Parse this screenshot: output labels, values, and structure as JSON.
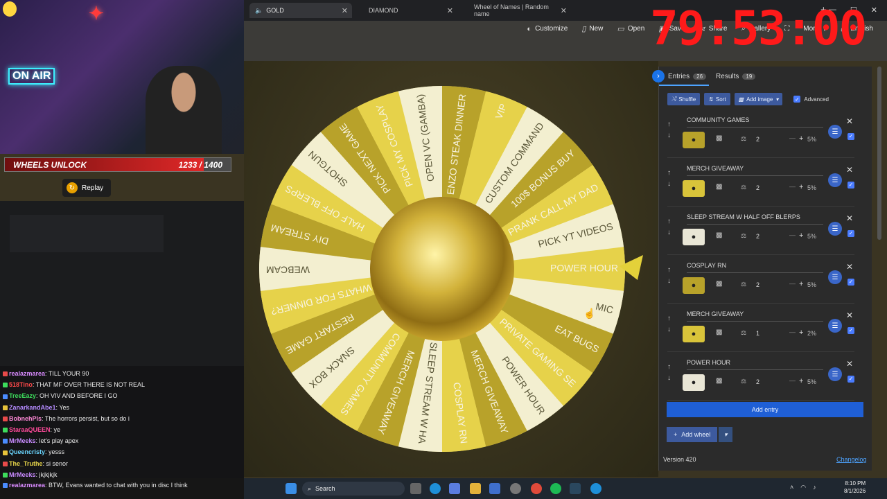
{
  "browser": {
    "tabs": [
      {
        "label": "GOLD",
        "active": true
      },
      {
        "label": "DIAMOND",
        "active": false
      },
      {
        "label": "Wheel of Names | Random name",
        "active": false
      }
    ],
    "new_tab_icon": "plus-icon"
  },
  "timer": {
    "text": "79:53:00"
  },
  "menu": {
    "customize": "Customize",
    "new": "New",
    "open": "Open",
    "save": "Save",
    "share": "Share",
    "gallery": "Gallery",
    "more": "More",
    "language": "English"
  },
  "stream": {
    "on_air": "ON AIR",
    "unlock_label": "WHEELS UNLOCK",
    "unlock_count": "1233 / 1400",
    "unlock_progress": 0.88,
    "replay": "Replay"
  },
  "wheel": {
    "colors": {
      "gold_dark": "#b8a22a",
      "gold_light": "#e6d24a",
      "cream": "#f3efd0"
    },
    "segments": [
      "POWER HOUR",
      "MIC",
      "EAT BUGS",
      "PRIVATE GAMING SE",
      "POWER HOUR",
      "MERCH GIVEAWAY",
      "COSPLAY RN",
      "SLEEP STREAM W HA",
      "MERCH GIVEAWAY",
      "COMMUNITY GAMES",
      "SNACK BOX",
      "RESTART GAME",
      "WHATS FOR DINNER?",
      "WEBCAM",
      "DIY STREAM",
      "HALF OFF BLERPS",
      "SHOTGUN",
      "PICK NEXT GAME",
      "PICK MY COSPLAY",
      "OPEN VC (GAMBA)",
      "ENZO STEAK DINNER",
      "VIP",
      "CUSTOM COMMAND",
      "100$ BONUS BUY",
      "PRANK CALL MY DAD",
      "PICK YT VIDEOS"
    ]
  },
  "panel": {
    "entries_tab": "Entries",
    "entries_count": "26",
    "results_tab": "Results",
    "results_count": "19",
    "shuffle": "Shuffle",
    "sort": "Sort",
    "add_image": "Add image",
    "advanced": "Advanced",
    "entries": [
      {
        "name": "COMMUNITY GAMES",
        "weight": "2",
        "pct": "5%",
        "color": "#b8a22a"
      },
      {
        "name": "MERCH GIVEAWAY",
        "weight": "2",
        "pct": "5%",
        "color": "#d9c43a"
      },
      {
        "name": "SLEEP STREAM W HALF OFF BLERPS",
        "weight": "2",
        "pct": "5%",
        "color": "#e9e6d6"
      },
      {
        "name": "COSPLAY RN",
        "weight": "2",
        "pct": "5%",
        "color": "#b8a22a"
      },
      {
        "name": "MERCH GIVEAWAY",
        "weight": "1",
        "pct": "2%",
        "color": "#d9c43a"
      },
      {
        "name": "POWER HOUR",
        "weight": "2",
        "pct": "5%",
        "color": "#e9e6d6"
      }
    ],
    "add_entry": "Add entry",
    "add_wheel": "Add wheel",
    "version": "Version 420",
    "changelog": "Changelog"
  },
  "chat": [
    {
      "user": "realazmarea",
      "color": "#d98bff",
      "msg": ": TILL YOUR 90"
    },
    {
      "user": "518Tino",
      "color": "#ff4a4a",
      "msg": ": THAT MF OVER THERE IS NOT REAL"
    },
    {
      "user": "TreeEazy",
      "color": "#3ddc5c",
      "msg": ": OH VIV AND BEFORE I GO"
    },
    {
      "user": "ZanarkandAbe1",
      "color": "#b58bff",
      "msg": ": Yes"
    },
    {
      "user": "BobnehPls",
      "color": "#ff8ad8",
      "msg": ": The horrors persist, but so do i"
    },
    {
      "user": "StaraaQUEEN",
      "color": "#ff4a9a",
      "msg": ": ye"
    },
    {
      "user": "MrMeeks",
      "color": "#c98bff",
      "msg": ": let's play apex"
    },
    {
      "user": "Queencristy",
      "color": "#6ad6ff",
      "msg": ": yesss"
    },
    {
      "user": "The_Truthe",
      "color": "#e6d44a",
      "msg": ": si senor"
    },
    {
      "user": "MrMeeks",
      "color": "#c98bff",
      "msg": ": jkjkjkjk"
    },
    {
      "user": "realazmarea",
      "color": "#d98bff",
      "msg": ": BTW, Evans wanted to chat with you in disc I think"
    }
  ],
  "taskbar": {
    "search": "Search",
    "time": "8:10 PM",
    "date": "8/1/2026"
  }
}
